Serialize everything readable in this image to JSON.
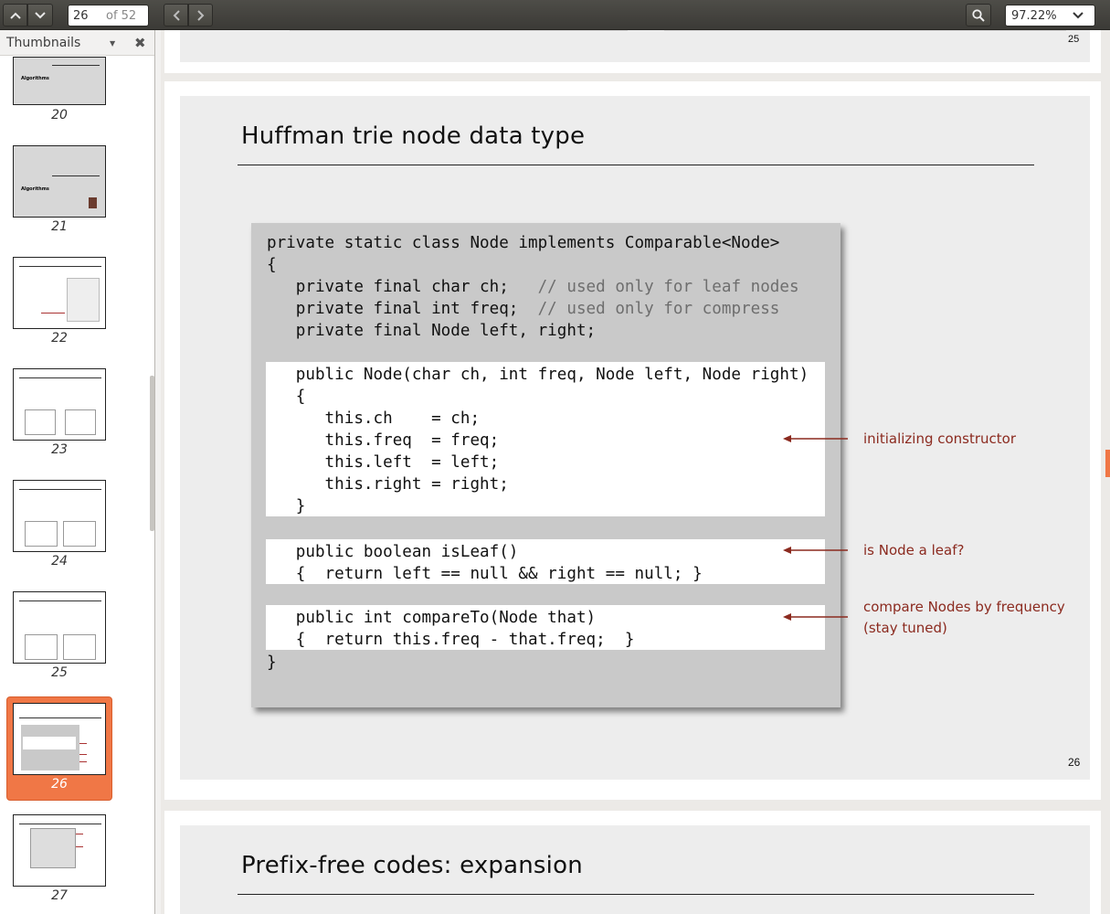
{
  "toolbar": {
    "page_current": "26",
    "page_of": "of 52",
    "zoom": "97.22%"
  },
  "sidebar": {
    "header": "Thumbnails",
    "thumbnails": [
      {
        "num": "20"
      },
      {
        "num": "21"
      },
      {
        "num": "22"
      },
      {
        "num": "23"
      },
      {
        "num": "24"
      },
      {
        "num": "25"
      },
      {
        "num": "26",
        "selected": true
      },
      {
        "num": "27"
      }
    ]
  },
  "pages": {
    "prev_slide_num": "25",
    "slide26": {
      "title": "Huffman trie node data type",
      "number": "26",
      "code": {
        "header1": "private static class Node implements Comparable<Node>",
        "brace_open": "{",
        "field1": "   private final char ch;   ",
        "field1_comment": "// used only for leaf nodes",
        "field2": "   private final int freq;  ",
        "field2_comment": "// used only for compress",
        "field3": "   private final Node left, right;",
        "ctor1": "   public Node(char ch, int freq, Node left, Node right)",
        "ctor2": "   {",
        "ctor3": "      this.ch    = ch;",
        "ctor4": "      this.freq  = freq;",
        "ctor5": "      this.left  = left;",
        "ctor6": "      this.right = right;",
        "ctor7": "   }",
        "leaf1": "   public boolean isLeaf()",
        "leaf2": "   {  return left == null && right == null; }",
        "cmp1": "   public int compareTo(Node that)",
        "cmp2": "   {  return this.freq - that.freq;  }",
        "brace_close": "}"
      },
      "annotations": {
        "ctor": "initializing constructor",
        "leaf": "is Node a leaf?",
        "cmp_line1": "compare Nodes by frequency",
        "cmp_line2": "(stay tuned)"
      }
    },
    "slide27": {
      "title": "Prefix-free codes:  expansion"
    }
  },
  "colors": {
    "accent": "#f07746",
    "annotation": "#8b2a1f",
    "code_panel": "#c9c9c9",
    "slide_bg": "#ededed"
  }
}
